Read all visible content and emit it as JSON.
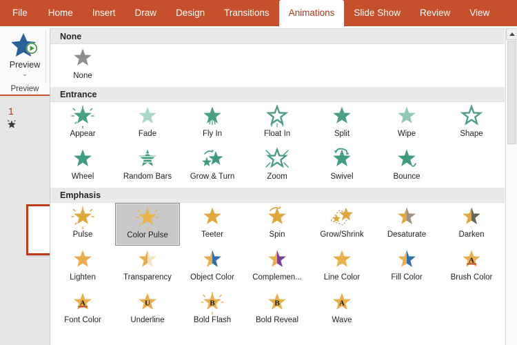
{
  "app": {
    "name": "PowerPoint",
    "ribbon_accent": "#c5502b",
    "active_tab_text_color": "#b03a1a"
  },
  "tabs": [
    {
      "label": "File",
      "name": "tab-file",
      "active": false
    },
    {
      "label": "Home",
      "name": "tab-home",
      "active": false
    },
    {
      "label": "Insert",
      "name": "tab-insert",
      "active": false
    },
    {
      "label": "Draw",
      "name": "tab-draw",
      "active": false
    },
    {
      "label": "Design",
      "name": "tab-design",
      "active": false
    },
    {
      "label": "Transitions",
      "name": "tab-transitions",
      "active": false
    },
    {
      "label": "Animations",
      "name": "tab-animations",
      "active": true
    },
    {
      "label": "Slide Show",
      "name": "tab-slide-show",
      "active": false
    },
    {
      "label": "Review",
      "name": "tab-review",
      "active": false
    },
    {
      "label": "View",
      "name": "tab-view",
      "active": false
    }
  ],
  "preview_group": {
    "button_label": "Preview",
    "dropdown_glyph": "⌄",
    "group_label": "Preview",
    "icon": "preview-star-play-icon",
    "star_color": "#2a6099",
    "play_color": "#3c9a3c"
  },
  "slide_pane": {
    "slide_number": "1",
    "animation_marker": "animation-star-icon",
    "thumbnail_border_color": "#c0391b"
  },
  "scrollbar": {
    "up_arrow": "scroll-up-arrow-icon",
    "thumb": "scrollbar-thumb"
  },
  "gallery": {
    "sections": [
      {
        "title": "None",
        "name": "section-none",
        "rows": [
          [
            {
              "label": "None",
              "name": "anim-none",
              "style": "plain",
              "color": "#8c8c8c",
              "selected": false
            }
          ]
        ]
      },
      {
        "title": "Entrance",
        "name": "section-entrance",
        "rows": [
          [
            {
              "label": "Appear",
              "name": "anim-appear",
              "style": "sparkle",
              "color": "#4a9e84",
              "selected": false
            },
            {
              "label": "Fade",
              "name": "anim-fade",
              "style": "faded",
              "color": "#8fc9b8",
              "selected": false
            },
            {
              "label": "Fly In",
              "name": "anim-fly-in",
              "style": "flyin",
              "color": "#4a9e84",
              "selected": false
            },
            {
              "label": "Float In",
              "name": "anim-float-in",
              "style": "floatin",
              "color": "#4a9e84",
              "selected": false
            },
            {
              "label": "Split",
              "name": "anim-split",
              "style": "split",
              "color": "#4a9e84",
              "selected": false
            },
            {
              "label": "Wipe",
              "name": "anim-wipe",
              "style": "wipe",
              "color": "#7cbda8",
              "selected": false
            },
            {
              "label": "Shape",
              "name": "anim-shape",
              "style": "outline",
              "color": "#4a9e84",
              "selected": false
            }
          ],
          [
            {
              "label": "Wheel",
              "name": "anim-wheel",
              "style": "plain",
              "color": "#3f9a80",
              "selected": false
            },
            {
              "label": "Random Bars",
              "name": "anim-random-bars",
              "style": "bars",
              "color": "#3f9a80",
              "selected": false
            },
            {
              "label": "Grow & Turn",
              "name": "anim-grow-and-turn",
              "style": "growturn",
              "color": "#3f9a80",
              "selected": false
            },
            {
              "label": "Zoom",
              "name": "anim-zoom",
              "style": "zoom",
              "color": "#3f9a80",
              "selected": false
            },
            {
              "label": "Swivel",
              "name": "anim-swivel",
              "style": "swivel",
              "color": "#3f9a80",
              "selected": false
            },
            {
              "label": "Bounce",
              "name": "anim-bounce",
              "style": "bounce",
              "color": "#3f9a80",
              "selected": false
            }
          ]
        ]
      },
      {
        "title": "Emphasis",
        "name": "section-emphasis",
        "rows": [
          [
            {
              "label": "Pulse",
              "name": "anim-pulse",
              "style": "sparkle",
              "color": "#e0a83c",
              "selected": false
            },
            {
              "label": "Color Pulse",
              "name": "anim-color-pulse",
              "style": "sparkle",
              "color": "#e8b44a",
              "selected": true
            },
            {
              "label": "Teeter",
              "name": "anim-teeter",
              "style": "plain",
              "color": "#e0a83c",
              "selected": false
            },
            {
              "label": "Spin",
              "name": "anim-spin",
              "style": "spin",
              "color": "#e0a83c",
              "selected": false
            },
            {
              "label": "Grow/Shrink",
              "name": "anim-grow-shrink",
              "style": "growshrink",
              "color": "#e0a83c",
              "selected": false
            },
            {
              "label": "Desaturate",
              "name": "anim-desaturate",
              "style": "half",
              "color": "#e0a83c",
              "color2": "#9a9183",
              "selected": false
            },
            {
              "label": "Darken",
              "name": "anim-darken",
              "style": "half",
              "color": "#e0a83c",
              "color2": "#6b6355",
              "selected": false
            }
          ],
          [
            {
              "label": "Lighten",
              "name": "anim-lighten",
              "style": "plain",
              "color": "#eaae4a",
              "selected": false
            },
            {
              "label": "Transparency",
              "name": "anim-transparency",
              "style": "half",
              "color": "#eaae4a",
              "color2": "#f7e3bd",
              "selected": false
            },
            {
              "label": "Object Color",
              "name": "anim-object-color",
              "style": "half",
              "color": "#eaae4a",
              "color2": "#2d6fb0",
              "selected": false
            },
            {
              "label": "Complemen...",
              "name": "anim-complement",
              "style": "half",
              "color": "#eaae4a",
              "color2": "#7b3f9e",
              "selected": false
            },
            {
              "label": "Line Color",
              "name": "anim-line-color",
              "style": "plain",
              "color": "#eaae4a",
              "selected": false
            },
            {
              "label": "Fill Color",
              "name": "anim-fill-color",
              "style": "half",
              "color": "#eaae4a",
              "color2": "#2d6fb0",
              "selected": false
            },
            {
              "label": "Brush Color",
              "name": "anim-brush-color",
              "style": "letter",
              "color": "#eaae4a",
              "glyph": "A",
              "underline": "#c0391b",
              "selected": false
            }
          ],
          [
            {
              "label": "Font Color",
              "name": "anim-font-color",
              "style": "letter",
              "color": "#eaae4a",
              "glyph": "A",
              "underline": "#c0391b",
              "selected": false
            },
            {
              "label": "Underline",
              "name": "anim-underline",
              "style": "letter",
              "color": "#eaae4a",
              "glyph": "U",
              "selected": false
            },
            {
              "label": "Bold Flash",
              "name": "anim-bold-flash",
              "style": "letterspark",
              "color": "#eaae4a",
              "glyph": "B",
              "selected": false
            },
            {
              "label": "Bold Reveal",
              "name": "anim-bold-reveal",
              "style": "letter",
              "color": "#eaae4a",
              "glyph": "B",
              "selected": false
            },
            {
              "label": "Wave",
              "name": "anim-wave",
              "style": "letter",
              "color": "#eaae4a",
              "glyph": "A",
              "selected": false
            }
          ]
        ]
      }
    ]
  }
}
